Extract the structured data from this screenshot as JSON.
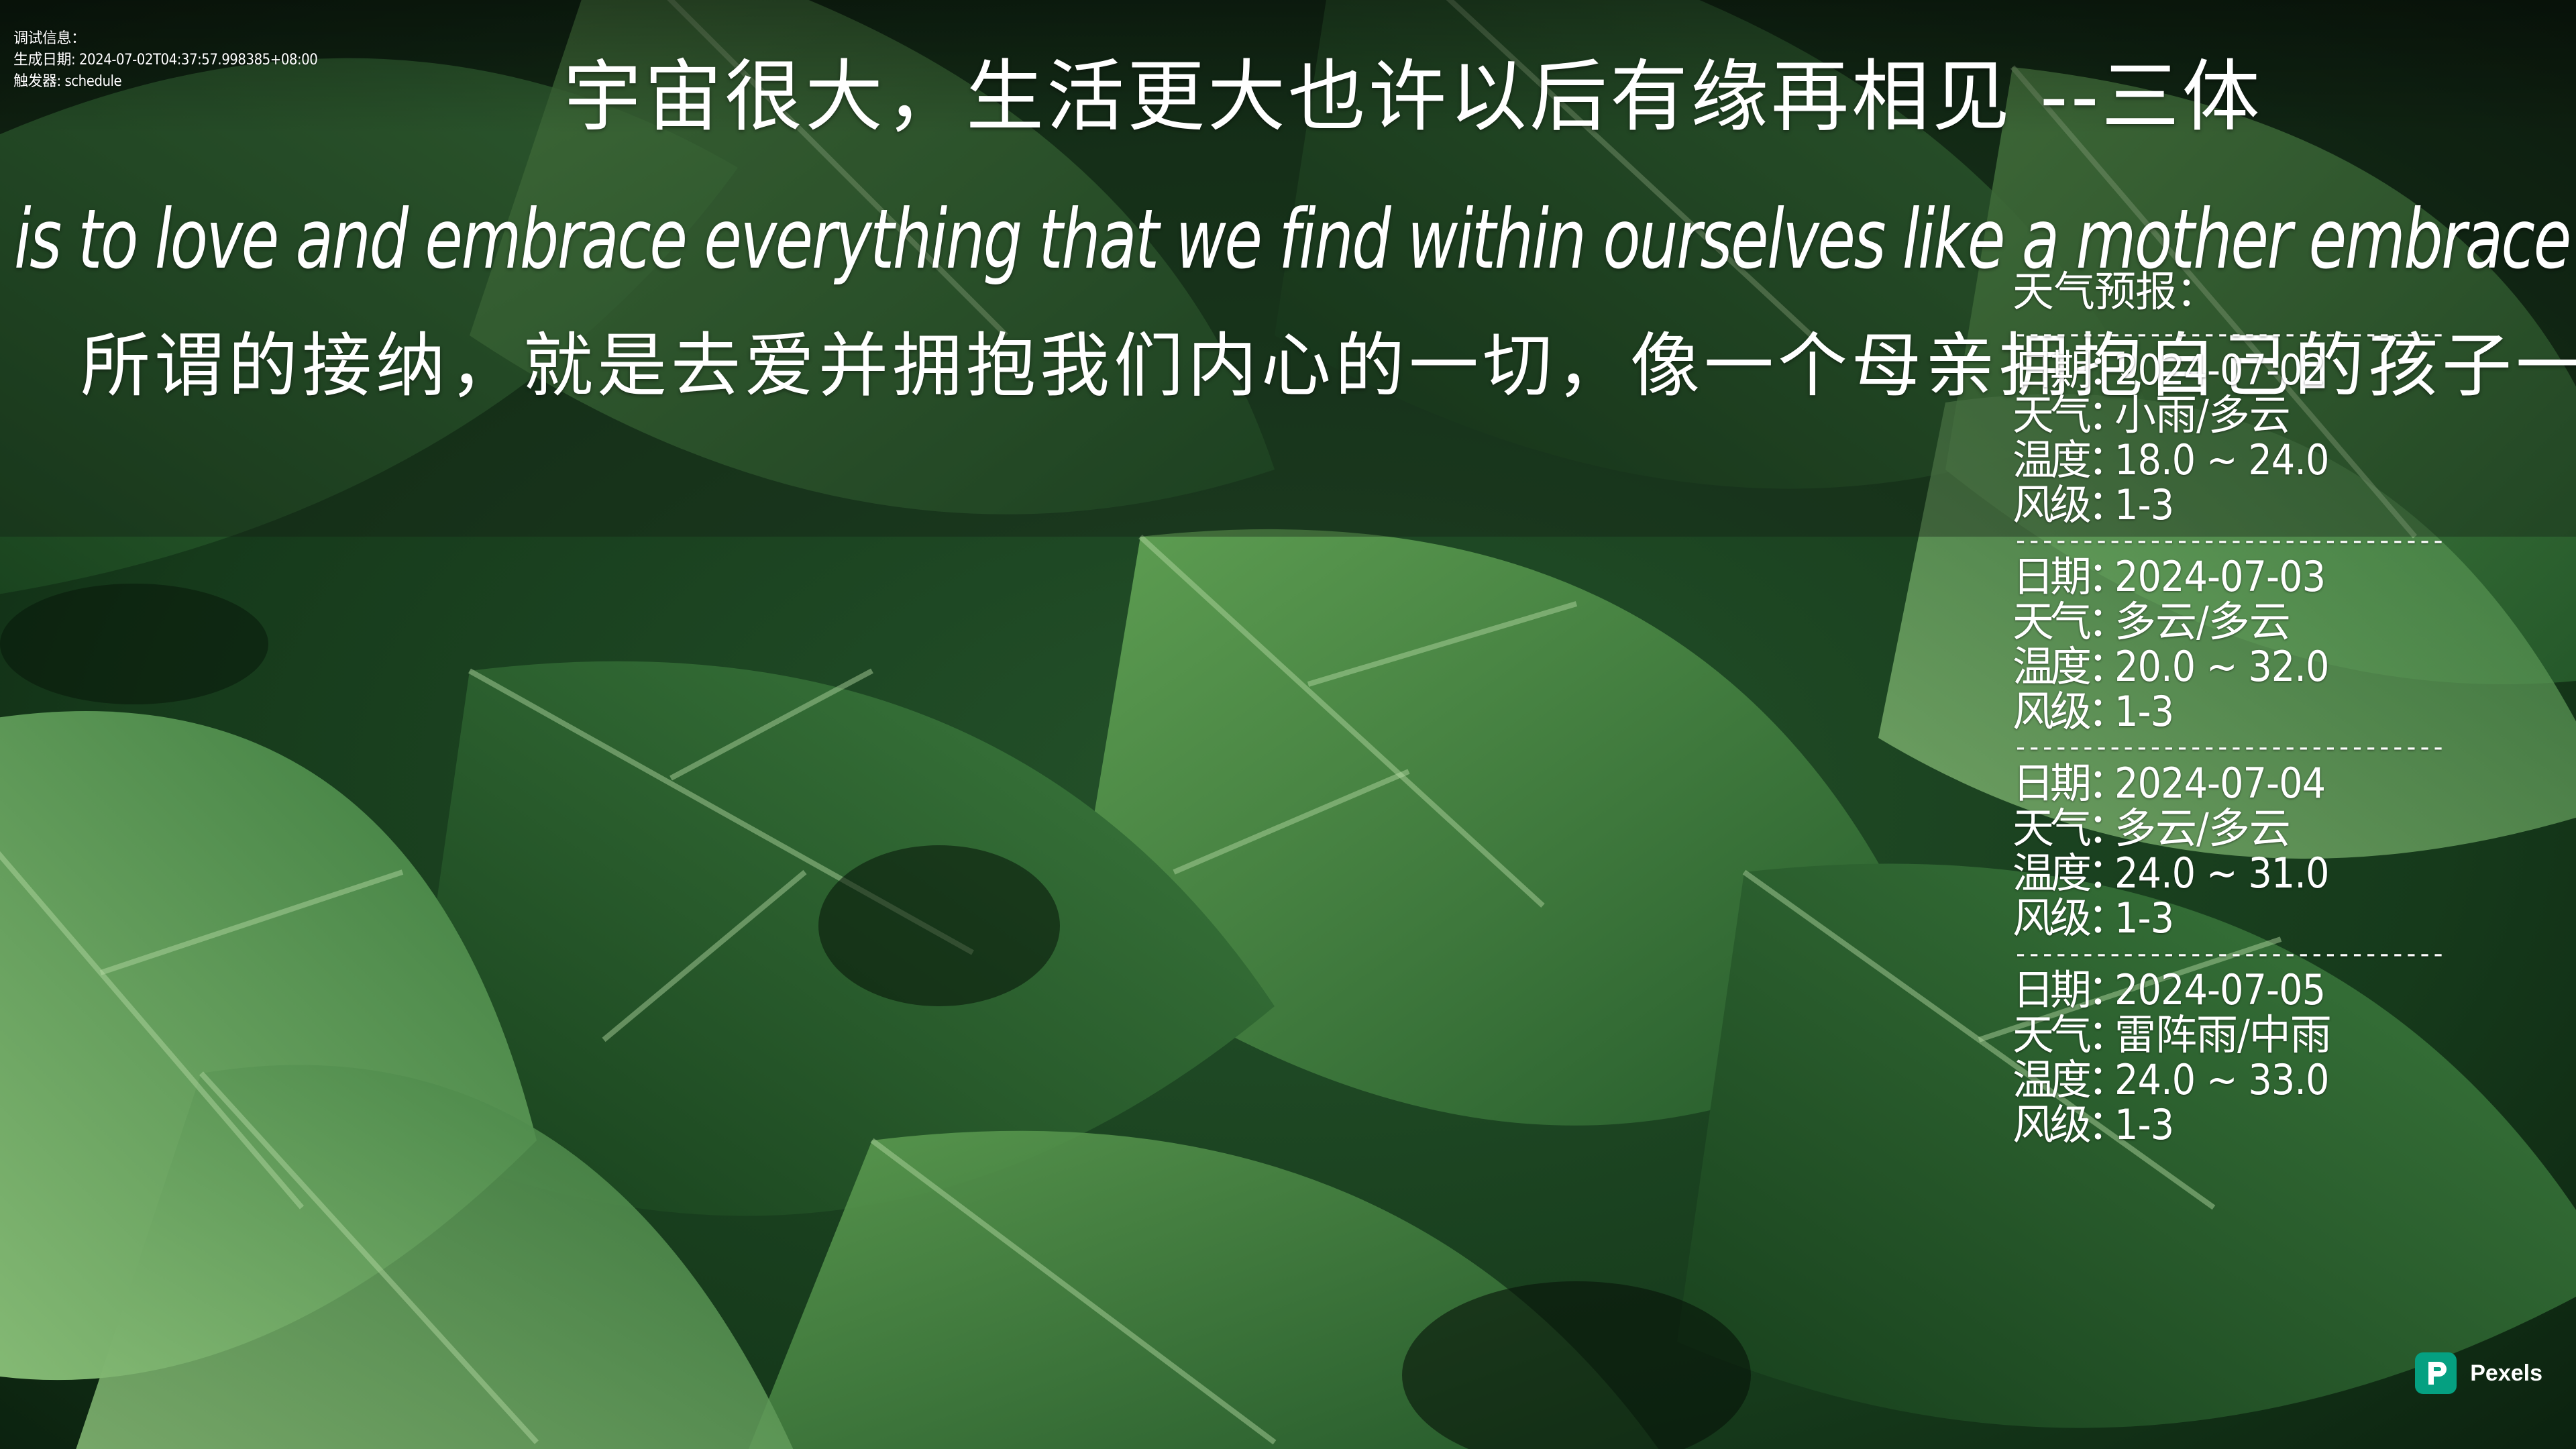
{
  "debug": {
    "line1": "调试信息：",
    "line2": "生成日期: 2024-07-02T04:37:57.998385+08:00",
    "line3": "触发器: schedule"
  },
  "quotes": {
    "main_cn": "宇宙很大，生活更大也许以后有缘再相见    --三体",
    "en": "e is to love and embrace everything that we find within ourselves like a mother embrace",
    "sub_cn": "所谓的接纳，就是去爱并拥抱我们内心的一切，像一个母亲拥抱自己的孩子一样。"
  },
  "weather": {
    "title": "天气预报：",
    "divider": "--------------------------------",
    "date_label": "日期",
    "weather_label": "天气",
    "temp_label": "温度",
    "wind_label": "风级",
    "sep": "：",
    "days": [
      {
        "date": "2024-07-02",
        "weather": "小雨/多云",
        "temp": "18.0 ~ 24.0",
        "wind": "1-3"
      },
      {
        "date": "2024-07-03",
        "weather": "多云/多云",
        "temp": "20.0 ~ 32.0",
        "wind": "1-3"
      },
      {
        "date": "2024-07-04",
        "weather": "多云/多云",
        "temp": "24.0 ~ 31.0",
        "wind": "1-3"
      },
      {
        "date": "2024-07-05",
        "weather": "雷阵雨/中雨",
        "temp": "24.0 ~ 33.0",
        "wind": "1-3"
      }
    ]
  },
  "watermark": {
    "brand": "Pexels",
    "logo_color": "#05a081"
  },
  "colors": {
    "leaf_dark": "#0f2a13",
    "leaf_mid": "#2f6d33",
    "leaf_light": "#6fae5e",
    "text": "#ffffff"
  }
}
